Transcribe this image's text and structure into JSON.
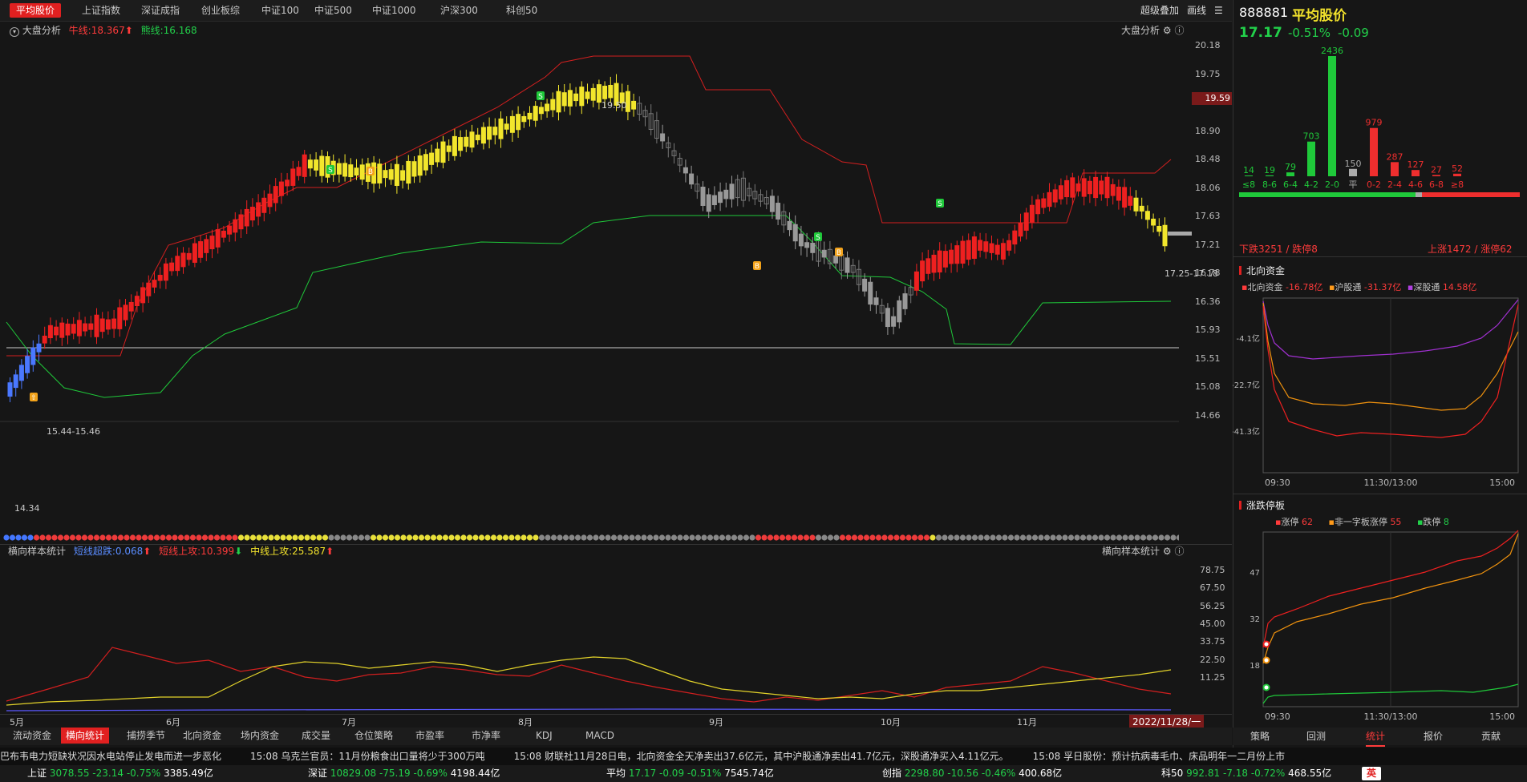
{
  "topbar": {
    "tabs": [
      "平均股价",
      "上证指数",
      "深证成指",
      "创业板综",
      "中证100",
      "中证500",
      "中证1000",
      "沪深300",
      "科创50"
    ],
    "overlay_label": "超级叠加",
    "draw_label": "画线"
  },
  "main_chart": {
    "panel_title": "大盘分析",
    "bull_label": "牛线:18.367",
    "bear_label": "熊线:16.168",
    "right_title": "大盘分析",
    "price_ticks": [
      "20.18",
      "19.75",
      "19.33",
      "18.90",
      "18.48",
      "18.06",
      "17.63",
      "17.21",
      "16.78",
      "16.36",
      "15.93",
      "15.51",
      "15.08",
      "14.66"
    ],
    "current_price_tag": "19.59",
    "annotation_high": "19.50",
    "annotation_low": "14.34",
    "annotation_mid": "15.44-15.46",
    "annotation_right": "17.25-17.18",
    "dot_colors": [
      "#4477ff",
      "#ee3b3b",
      "#e8e03a",
      "#888888"
    ]
  },
  "lower_chart": {
    "panel_title": "横向样本统计",
    "short_down": "短线超跌:0.068",
    "short_up": "短线上攻:10.399",
    "mid_up": "中线上攻:25.587",
    "right_title": "横向样本统计",
    "ticks": [
      "78.75",
      "67.50",
      "56.25",
      "45.00",
      "33.75",
      "22.50",
      "11.25"
    ]
  },
  "x_axis": {
    "labels": [
      "5月",
      "6月",
      "7月",
      "8月",
      "9月",
      "10月",
      "11月"
    ],
    "date_tag": "2022/11/28/一"
  },
  "bottom_tabs": [
    "流动资金",
    "横向统计",
    "捕捞季节",
    "北向资金",
    "场内资金",
    "成交量",
    "仓位策略",
    "市盈率",
    "市净率",
    "KDJ",
    "MACD"
  ],
  "right_panel": {
    "code": "888881",
    "name": "平均股价",
    "price": "17.17",
    "pct": "-0.51%",
    "change": "-0.09",
    "dist": {
      "categories": [
        "≤8",
        "8-6",
        "6-4",
        "4-2",
        "2-0",
        "平",
        "0-2",
        "2-4",
        "4-6",
        "6-8",
        "≥8"
      ],
      "values": [
        14,
        19,
        79,
        703,
        2436,
        150,
        979,
        287,
        127,
        27,
        52
      ]
    },
    "down_label": "下跌3251 / 跌停8",
    "up_label": "上涨1472 / 涨停62",
    "north": {
      "title": "北向资金",
      "l1": "北向资金",
      "v1": "-16.78亿",
      "l2": "沪股通",
      "v2": "-31.37亿",
      "l3": "深股通",
      "v3": "14.58亿",
      "yticks": [
        "-4.1亿",
        "-22.7亿",
        "-41.3亿"
      ],
      "xticks": [
        "09:30",
        "11:30/13:00",
        "15:00"
      ]
    },
    "limit": {
      "title": "涨跌停板",
      "l1": "涨停",
      "v1": "62",
      "l2": "非一字板涨停",
      "v2": "55",
      "l3": "跌停",
      "v3": "8",
      "yticks": [
        "47",
        "32",
        "18"
      ],
      "xticks": [
        "09:30",
        "11:30/13:00",
        "15:00"
      ]
    },
    "tabs": [
      "策略",
      "回测",
      "统计",
      "报价",
      "贡献"
    ]
  },
  "ticker": {
    "text": "巴布韦电力短缺状况因水电站停止发电而进一步恶化　　　15:08 乌克兰官员：11月份粮食出口量将少于300万吨　　　15:08 财联社11月28日电，北向资金全天净卖出37.6亿元，其中沪股通净卖出41.7亿元，深股通净买入4.11亿元。　　　15:08 孚日股份：预计抗病毒毛巾、床品明年一二月份上市"
  },
  "indexbar": {
    "items": [
      {
        "name": "上证",
        "val": "3078.55",
        "chg": "-23.14",
        "pct": "-0.75%",
        "amt": "3385.49亿"
      },
      {
        "name": "深证",
        "val": "10829.08",
        "chg": "-75.19",
        "pct": "-0.69%",
        "amt": "4198.44亿"
      },
      {
        "name": "平均",
        "val": "17.17",
        "chg": "-0.09",
        "pct": "-0.51%",
        "amt": "7545.74亿"
      },
      {
        "name": "创指",
        "val": "2298.80",
        "chg": "-10.56",
        "pct": "-0.46%",
        "amt": "400.68亿"
      },
      {
        "name": "科50",
        "val": "992.81",
        "chg": "-7.18",
        "pct": "-0.72%",
        "amt": "468.55亿"
      }
    ],
    "ime_label": "英"
  }
}
